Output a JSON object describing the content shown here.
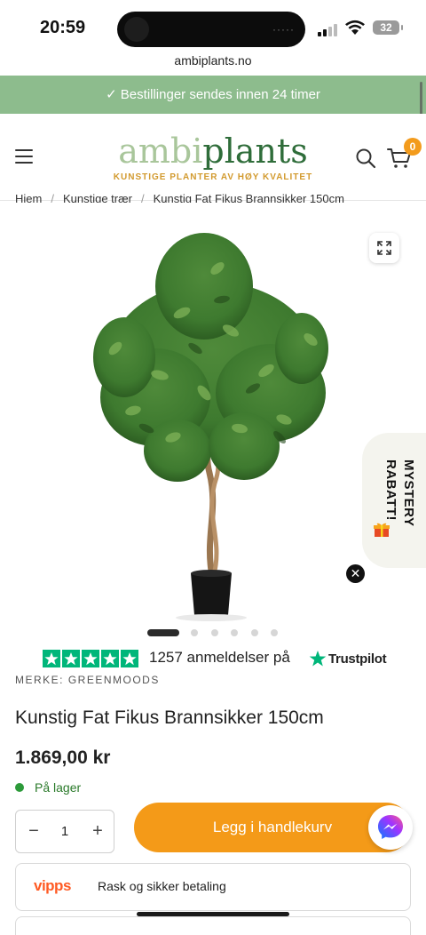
{
  "status_bar": {
    "time": "20:59",
    "battery": "32"
  },
  "browser": {
    "url": "ambiplants.no"
  },
  "banner": {
    "text": "✓ Bestillinger sendes innen 24 timer"
  },
  "header": {
    "logo_part1": "ambi",
    "logo_part2": "plants",
    "tagline": "KUNSTIGE PLANTER AV HØY KVALITET",
    "cart_count": "0"
  },
  "breadcrumb": {
    "items": [
      "Hjem",
      "Kunstige trær",
      "Kunstig Fat Fikus Brannsikker 150cm"
    ]
  },
  "gallery": {
    "image_count": 6,
    "active_index": 0
  },
  "mystery": {
    "line1": "MYSTERY",
    "line2": "RABATT!"
  },
  "trustpilot": {
    "rating_stars": 5,
    "review_text": "1257 anmeldelser på",
    "brand": "Trustpilot"
  },
  "product": {
    "brand_line": "MERKE: GREENMOODS",
    "title": "Kunstig Fat Fikus Brannsikker 150cm",
    "price": "1.869,00 kr",
    "stock": "På lager"
  },
  "cart": {
    "qty_minus": "−",
    "qty_value": "1",
    "qty_plus": "+",
    "add_label": "Legg i handlekurv"
  },
  "payment": {
    "logo": "vipps",
    "text": "Rask og sikker betaling"
  },
  "colors": {
    "banner": "#8dbc8d",
    "accent": "#f49a18",
    "brand_dark": "#2f6d3a",
    "trustpilot": "#00b67a"
  }
}
